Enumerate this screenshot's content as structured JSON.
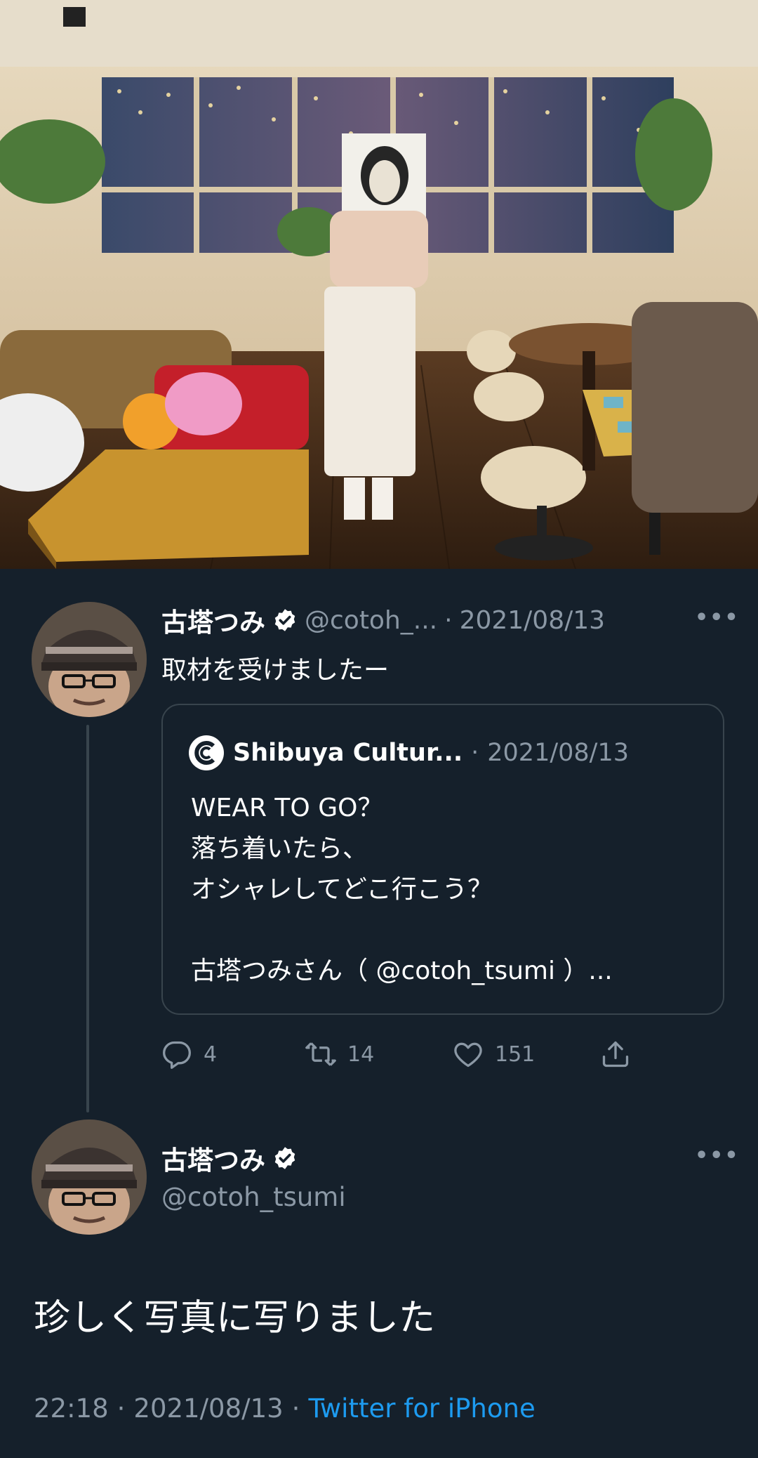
{
  "tweet": {
    "author_name": "古塔つみ",
    "author_handle": "@cotoh_...",
    "separator": "·",
    "date": "2021/08/13",
    "text": "取材を受けましたー",
    "more": "•••",
    "stats": {
      "replies": "4",
      "retweets": "14",
      "likes": "151"
    }
  },
  "quoted": {
    "name": "Shibuya Cultur...",
    "separator": "·",
    "date": "2021/08/13",
    "text": "WEAR TO GO？\n落ち着いたら、\nオシャレしてどこ行こう？\n\n古塔つみさん（ @cotoh_tsumi ）..."
  },
  "reply": {
    "author_name": "古塔つみ",
    "author_handle": "@cotoh_tsumi",
    "more": "•••",
    "text": "珍しく写真に写りました",
    "time": "22:18",
    "separator": "·",
    "date": "2021/08/13",
    "separator2": "·",
    "source": "Twitter for iPhone"
  },
  "colors": {
    "background": "#15202b",
    "text_primary": "#ffffff",
    "text_muted": "#8b98a5",
    "link": "#1d9bf0",
    "border": "#38444d"
  },
  "icons": [
    "verified-badge-icon",
    "more-icon",
    "reply-icon",
    "retweet-icon",
    "like-icon",
    "share-icon",
    "shibuya-culture-logo-icon"
  ]
}
